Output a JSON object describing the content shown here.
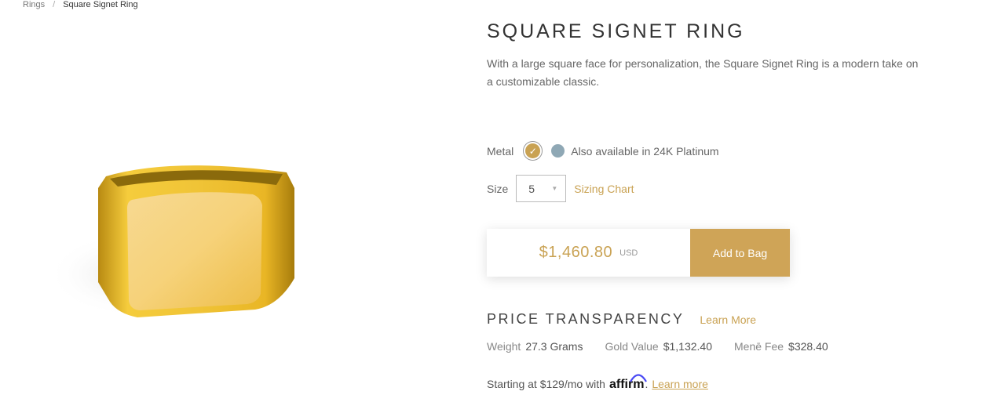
{
  "breadcrumb": {
    "items": [
      "Rings",
      "Square Signet Ring"
    ],
    "separator": "/"
  },
  "product": {
    "title": "SQUARE SIGNET RING",
    "description": "With a large square face for personalization, the Square Signet Ring is a modern take on a customizable classic.",
    "image_icon": "gold-signet-ring"
  },
  "metal": {
    "label": "Metal",
    "selected_swatch_color": "#c9a253",
    "selected_icon": "check-icon",
    "alt_swatch_color": "#8fa8b5",
    "alt_text": "Also available in 24K Platinum"
  },
  "size": {
    "label": "Size",
    "value": "5",
    "sizing_link": "Sizing Chart"
  },
  "purchase": {
    "price": "$1,460.80",
    "currency": "USD",
    "add_to_bag": "Add to Bag"
  },
  "transparency": {
    "title": "PRICE TRANSPARENCY",
    "learn_more": "Learn More",
    "stats": [
      {
        "label": "Weight",
        "value": "27.3 Grams"
      },
      {
        "label": "Gold Value",
        "value": "$1,132.40"
      },
      {
        "label": "Menē Fee",
        "value": "$328.40"
      }
    ]
  },
  "financing": {
    "text": "Starting at $129/mo with",
    "brand": "affirm",
    "suffix": ".",
    "link": "Learn more"
  },
  "colors": {
    "accent": "#c9a253",
    "button": "#cfa457"
  }
}
